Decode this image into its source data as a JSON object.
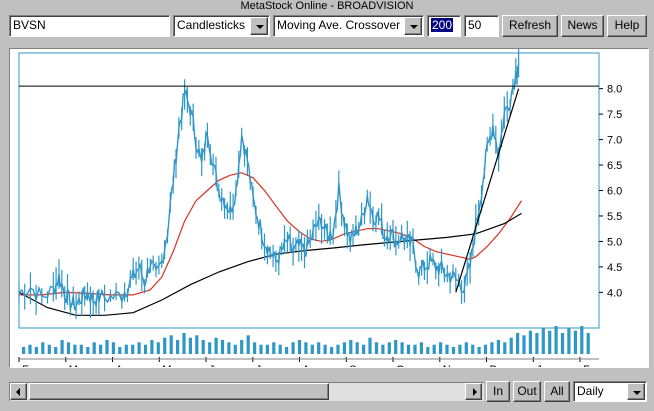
{
  "window_title": "MetaStock Online - BROADVISION",
  "toolbar": {
    "symbol_value": "BVSN",
    "chart_style": "Candlesticks",
    "indicator": "Moving Ave. Crossover",
    "period_long": "200",
    "period_short": "50",
    "refresh_label": "Refresh",
    "news_label": "News",
    "help_label": "Help"
  },
  "bottom": {
    "in_label": "In",
    "out_label": "Out",
    "all_label": "All",
    "interval": "Daily"
  },
  "colors": {
    "price": "#2f97c7",
    "ma_short": "#d83020",
    "ma_long": "#000000",
    "volume": "#2f97c7",
    "trend": "#000000"
  },
  "chart_data": {
    "type": "line",
    "title": "",
    "xlabel": "",
    "ylabel": "",
    "ylim": [
      3.3,
      8.7
    ],
    "yticks": [
      "8.0",
      "7.5",
      "7.0",
      "6.5",
      "6.0",
      "5.5",
      "5.0",
      "4.5",
      "4.0"
    ],
    "ytick_values": [
      8.0,
      7.5,
      7.0,
      6.5,
      6.0,
      5.5,
      5.0,
      4.5,
      4.0
    ],
    "xrange": [
      0,
      100
    ],
    "month_labels": [
      "F",
      "M",
      "A",
      "M",
      "J",
      "J",
      "A",
      "S",
      "O",
      "N",
      "D",
      "J",
      "F"
    ],
    "month_positions": [
      0,
      8.5,
      17,
      25.5,
      34,
      42.5,
      51,
      59.5,
      68,
      76.5,
      85,
      93.5,
      102
    ],
    "horizontal_line": 8.05,
    "series": [
      {
        "values": [
          [
            0,
            4.0
          ],
          [
            2,
            4.1
          ],
          [
            4,
            3.9
          ],
          [
            6,
            4.05
          ],
          [
            7,
            4.3
          ],
          [
            8,
            4.0
          ],
          [
            9,
            3.8
          ],
          [
            10,
            3.75
          ],
          [
            11,
            3.9
          ],
          [
            12,
            4.0
          ],
          [
            13,
            3.85
          ],
          [
            14,
            3.9
          ],
          [
            16,
            3.9
          ],
          [
            18,
            3.95
          ],
          [
            19,
            4.1
          ],
          [
            20,
            4.3
          ],
          [
            21,
            4.5
          ],
          [
            22,
            4.2
          ],
          [
            23,
            4.6
          ],
          [
            24,
            4.3
          ],
          [
            25,
            4.6
          ],
          [
            26,
            5.2
          ],
          [
            27,
            6.2
          ],
          [
            28,
            7.2
          ],
          [
            29,
            7.9
          ],
          [
            30,
            7.6
          ],
          [
            31,
            7.0
          ],
          [
            32,
            6.5
          ],
          [
            33,
            7.2
          ],
          [
            34,
            6.5
          ],
          [
            35,
            6.0
          ],
          [
            36,
            5.8
          ],
          [
            37,
            5.6
          ],
          [
            38,
            6.0
          ],
          [
            39,
            7.1
          ],
          [
            40,
            6.6
          ],
          [
            41,
            5.8
          ],
          [
            42,
            5.4
          ],
          [
            43,
            5.0
          ],
          [
            44,
            4.8
          ],
          [
            45,
            4.6
          ],
          [
            46,
            4.8
          ],
          [
            47,
            5.0
          ],
          [
            48,
            4.8
          ],
          [
            49,
            4.9
          ],
          [
            50,
            4.8
          ],
          [
            51,
            5.0
          ],
          [
            52,
            5.3
          ],
          [
            53,
            5.4
          ],
          [
            54,
            5.1
          ],
          [
            55,
            5.2
          ],
          [
            56,
            6.0
          ],
          [
            57,
            5.4
          ],
          [
            58,
            5.0
          ],
          [
            59,
            5.2
          ],
          [
            60,
            5.4
          ],
          [
            61,
            5.9
          ],
          [
            62,
            5.5
          ],
          [
            63,
            5.5
          ],
          [
            64,
            5.1
          ],
          [
            65,
            5.2
          ],
          [
            66,
            5.0
          ],
          [
            67,
            5.1
          ],
          [
            68,
            5.0
          ],
          [
            69,
            4.9
          ],
          [
            70,
            4.4
          ],
          [
            71,
            4.5
          ],
          [
            72,
            4.6
          ],
          [
            73,
            4.5
          ],
          [
            74,
            4.45
          ],
          [
            75,
            4.35
          ],
          [
            76,
            4.3
          ],
          [
            77,
            4.2
          ],
          [
            78,
            4.1
          ],
          [
            79,
            4.5
          ],
          [
            80,
            5.3
          ],
          [
            81,
            6.0
          ],
          [
            82,
            6.8
          ],
          [
            83,
            7.3
          ],
          [
            84,
            6.7
          ],
          [
            85,
            7.5
          ],
          [
            86,
            7.8
          ],
          [
            87,
            8.3
          ],
          [
            87.5,
            8.5
          ]
        ]
      },
      {
        "name": "",
        "values": [
          [
            0,
            3.95
          ],
          [
            4,
            3.95
          ],
          [
            8,
            4.0
          ],
          [
            12,
            3.98
          ],
          [
            16,
            3.95
          ],
          [
            20,
            3.95
          ],
          [
            23,
            4.05
          ],
          [
            25,
            4.3
          ],
          [
            27,
            4.8
          ],
          [
            29,
            5.4
          ],
          [
            31,
            5.8
          ],
          [
            33,
            6.0
          ],
          [
            35,
            6.2
          ],
          [
            37,
            6.3
          ],
          [
            39,
            6.35
          ],
          [
            41,
            6.25
          ],
          [
            43,
            6.0
          ],
          [
            45,
            5.7
          ],
          [
            47,
            5.4
          ],
          [
            49,
            5.2
          ],
          [
            51,
            5.05
          ],
          [
            53,
            5.0
          ],
          [
            55,
            5.05
          ],
          [
            57,
            5.15
          ],
          [
            59,
            5.2
          ],
          [
            61,
            5.25
          ],
          [
            63,
            5.25
          ],
          [
            65,
            5.2
          ],
          [
            67,
            5.15
          ],
          [
            69,
            5.05
          ],
          [
            71,
            4.9
          ],
          [
            73,
            4.8
          ],
          [
            75,
            4.75
          ],
          [
            77,
            4.7
          ],
          [
            79,
            4.65
          ],
          [
            80,
            4.7
          ],
          [
            82,
            4.9
          ],
          [
            84,
            5.15
          ],
          [
            86,
            5.45
          ],
          [
            88,
            5.8
          ]
        ]
      },
      {
        "name": "",
        "values": [
          [
            0,
            4.0
          ],
          [
            5,
            3.7
          ],
          [
            10,
            3.55
          ],
          [
            15,
            3.55
          ],
          [
            20,
            3.6
          ],
          [
            25,
            3.85
          ],
          [
            30,
            4.15
          ],
          [
            35,
            4.4
          ],
          [
            40,
            4.6
          ],
          [
            45,
            4.75
          ],
          [
            50,
            4.82
          ],
          [
            55,
            4.87
          ],
          [
            60,
            4.93
          ],
          [
            65,
            4.98
          ],
          [
            70,
            5.03
          ],
          [
            75,
            5.08
          ],
          [
            80,
            5.15
          ],
          [
            85,
            5.35
          ],
          [
            88,
            5.55
          ]
        ]
      }
    ],
    "trendline": [
      [
        76.5,
        4.0
      ],
      [
        87.5,
        8.0
      ]
    ],
    "volume": [
      3,
      4,
      3,
      5,
      4,
      3,
      6,
      5,
      4,
      4,
      3,
      5,
      4,
      6,
      5,
      3,
      4,
      4,
      5,
      4,
      6,
      5,
      7,
      8,
      6,
      9,
      7,
      8,
      6,
      5,
      7,
      6,
      5,
      4,
      6,
      8,
      5,
      4,
      4,
      5,
      4,
      3,
      5,
      6,
      5,
      4,
      5,
      4,
      3,
      4,
      5,
      6,
      5,
      4,
      7,
      5,
      4,
      5,
      6,
      5,
      4,
      4,
      5,
      3,
      4,
      5,
      4,
      3,
      4,
      5,
      4,
      3,
      4,
      5,
      6,
      5,
      7,
      9,
      8,
      10,
      9,
      11,
      10,
      12,
      9,
      11,
      10,
      12,
      9
    ]
  }
}
